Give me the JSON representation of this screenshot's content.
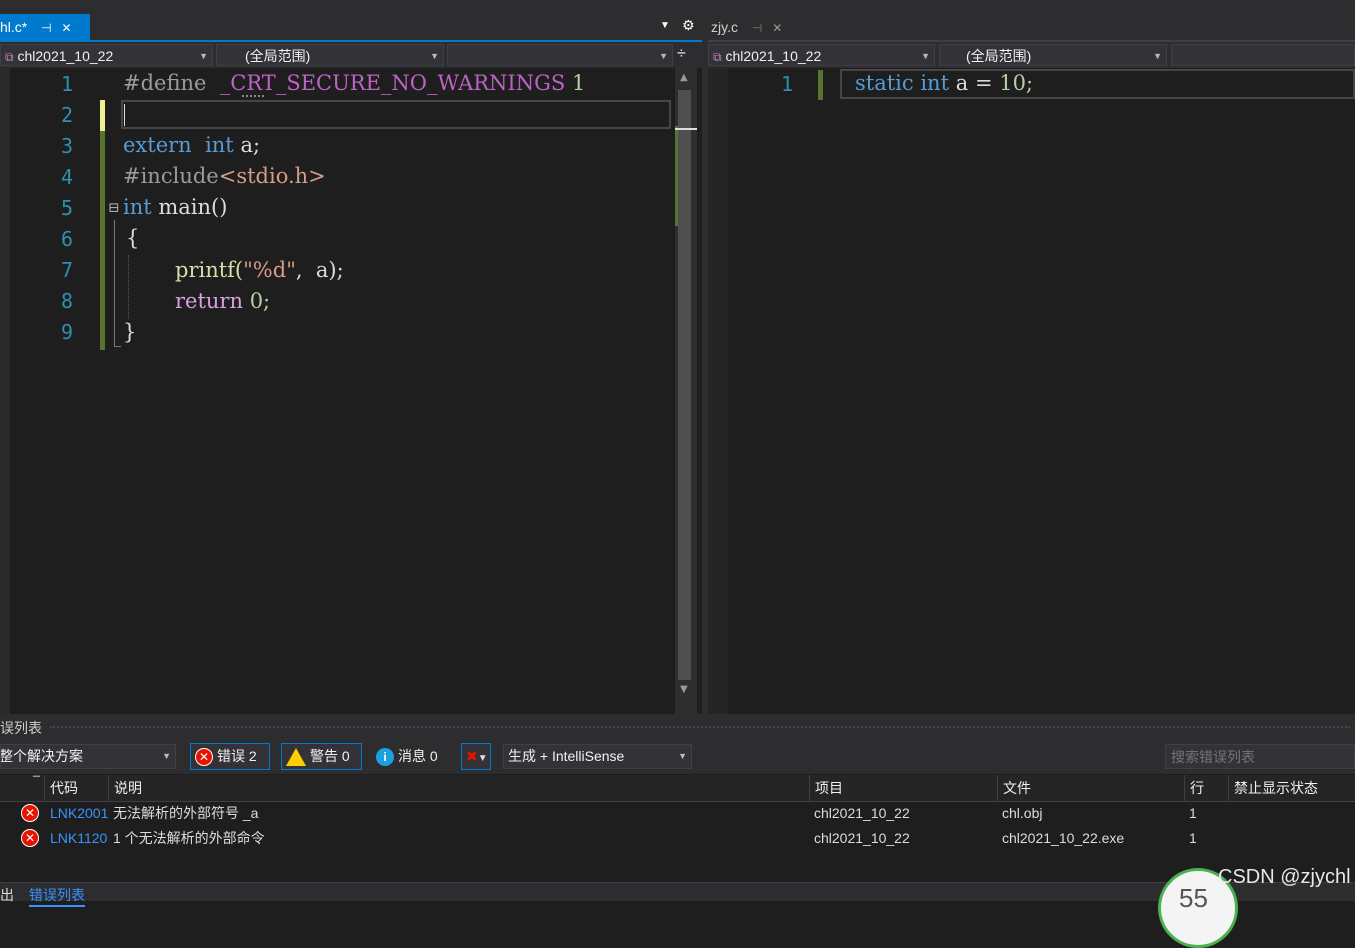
{
  "left_pane": {
    "tab_title": "hl.c*",
    "project_combo": "chl2021_10_22",
    "scope_combo": "(全局范围)",
    "member_combo": "",
    "line_numbers": [
      "1",
      "2",
      "3",
      "4",
      "5",
      "6",
      "7",
      "8",
      "9"
    ],
    "code": {
      "l1_directive": "#define",
      "l1_macro": "_CRT_SECURE_NO_WARNINGS",
      "l1_value": "1",
      "l3_extern": "extern",
      "l3_int": "int",
      "l3_rest": "a;",
      "l4_include": "#include",
      "l4_header": "<stdio.h>",
      "l5_fold": "⊟",
      "l5_int": "int",
      "l5_rest": "main()",
      "l6_open": "{",
      "l7_printf": "printf(",
      "l7_fmt": "\"%d\"",
      "l7_rest": ",  a);",
      "l8_return": "return",
      "l8_val": "0;",
      "l9_close": "}"
    }
  },
  "right_pane": {
    "tab_title": "zjy.c",
    "project_combo": "chl2021_10_22",
    "scope_combo": "(全局范围)",
    "member_combo": "",
    "line_numbers": [
      "1"
    ],
    "code": {
      "static": "static",
      "int": "int",
      "ident": "a",
      "eq": "=",
      "num": "10;"
    }
  },
  "error_list": {
    "title": "误列表",
    "scope_select": "整个解决方案",
    "errors_btn": "错误 2",
    "warnings_btn": "警告 0",
    "messages_btn": "消息 0",
    "build_select": "生成 + IntelliSense",
    "search_placeholder": "搜索错误列表",
    "columns": {
      "code": "代码",
      "desc": "说明",
      "project": "项目",
      "file": "文件",
      "line": "行",
      "suppress": "禁止显示状态"
    },
    "rows": [
      {
        "code": "LNK2001",
        "desc": "无法解析的外部符号 _a",
        "project": "chl2021_10_22",
        "file": "chl.obj",
        "line": "1"
      },
      {
        "code": "LNK1120",
        "desc": "1 个无法解析的外部命令",
        "project": "chl2021_10_22",
        "file": "chl2021_10_22.exe",
        "line": "1"
      }
    ]
  },
  "bottom_tabs": {
    "output": "出",
    "error_list": "错误列表"
  },
  "watermark": "CSDN @zjychl",
  "badge_number": "55"
}
